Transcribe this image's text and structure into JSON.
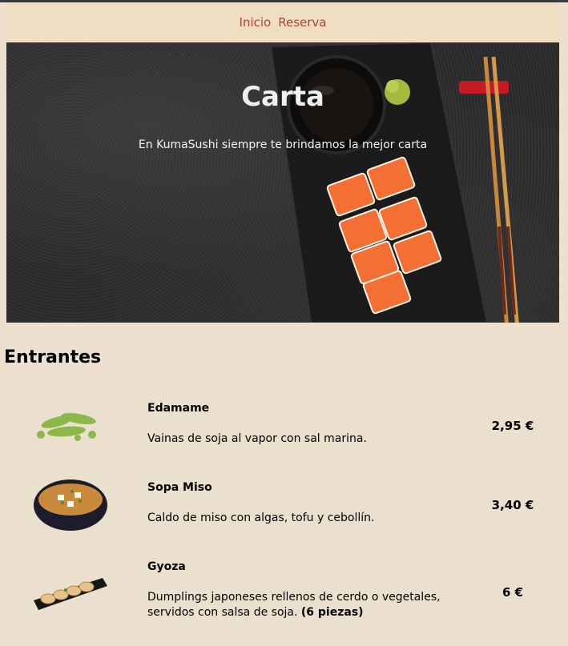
{
  "nav": {
    "items": [
      {
        "label": "Inicio"
      },
      {
        "label": "Reserva"
      }
    ]
  },
  "hero": {
    "title": "Carta",
    "subtitle": "En KumaSushi siempre te brindamos la mejor carta"
  },
  "section": {
    "title": "Entrantes"
  },
  "menu": {
    "items": [
      {
        "name": "Edamame",
        "description": "Vainas de soja al vapor con sal marina.",
        "price": "2,95 €",
        "image": "edamame-image"
      },
      {
        "name": "Sopa Miso",
        "description": "Caldo de miso con algas, tofu y cebollín.",
        "price": "3,40 €",
        "image": "miso-soup-image"
      },
      {
        "name": "Gyoza",
        "description": "Dumplings japoneses rellenos de cerdo o vegetales, servidos con salsa de soja.",
        "description_bold": "(6 piezas)",
        "price": "6 €",
        "image": "gyoza-image"
      }
    ]
  },
  "colors": {
    "page_bg": "#ede0cf",
    "nav_bg": "#efdec2",
    "nav_link": "#b0432f",
    "hero_bg": "#2b2b2b"
  }
}
